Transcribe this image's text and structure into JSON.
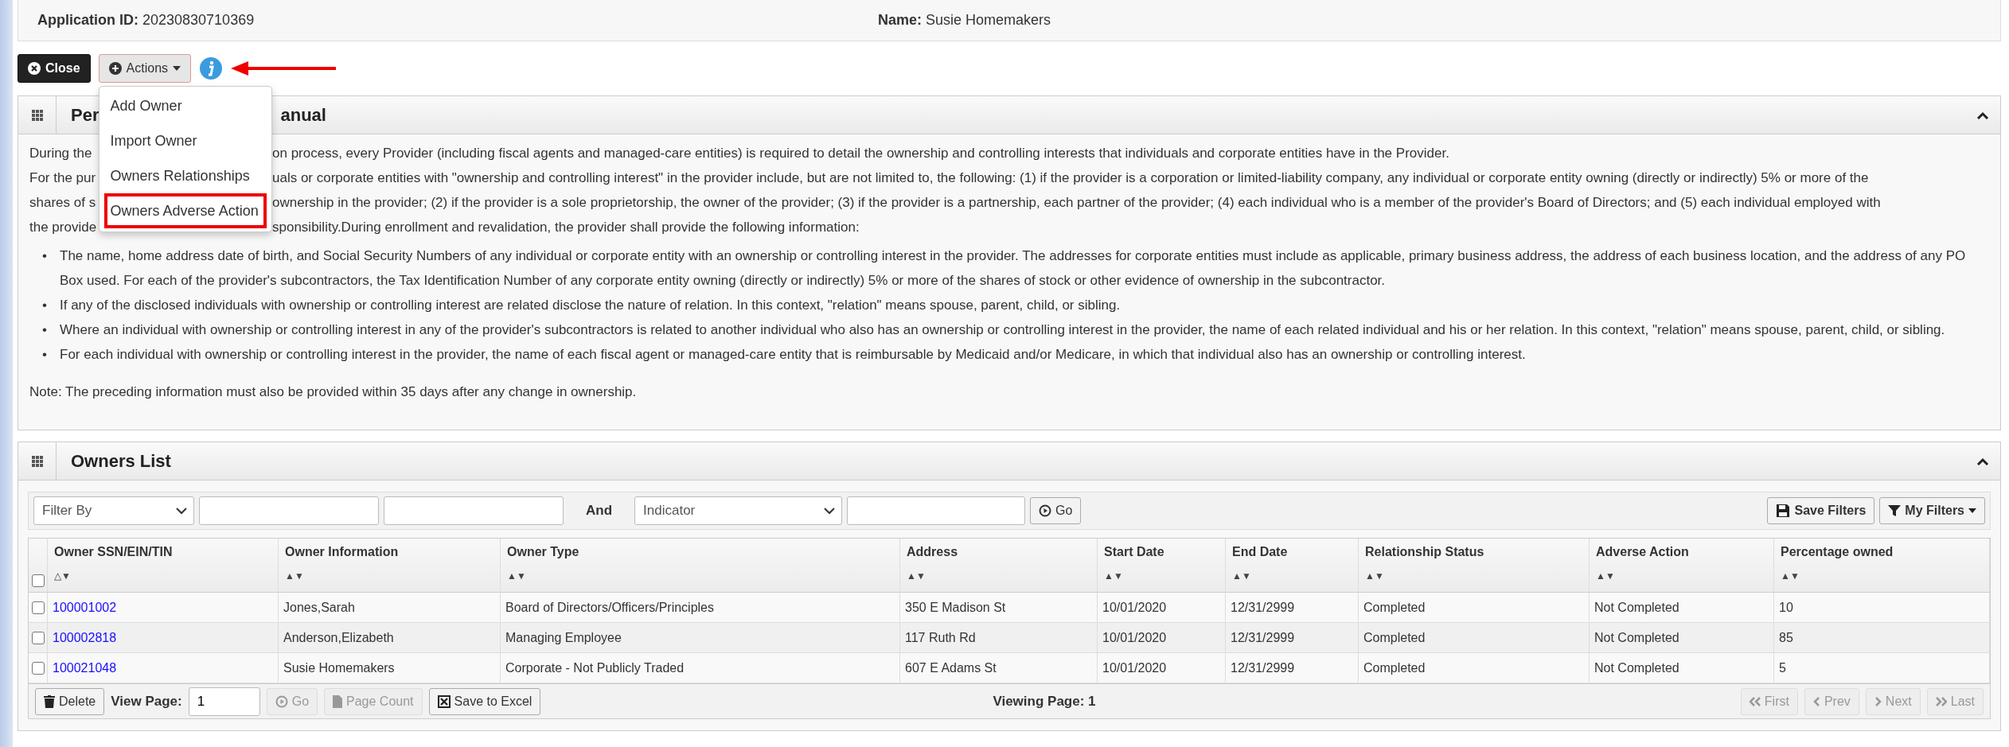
{
  "header": {
    "application_id_label": "Application ID:",
    "application_id": "20230830710369",
    "name_label": "Name:",
    "name": "Susie Homemakers"
  },
  "toolbar": {
    "close": "Close",
    "actions": "Actions",
    "actions_expanded": true,
    "info_arrow": true
  },
  "actions_menu": [
    {
      "label": "Add Owner",
      "highlighted": false
    },
    {
      "label": "Import Owner",
      "highlighted": false
    },
    {
      "label": "Owners Relationships",
      "highlighted": false
    },
    {
      "label": "Owners Adverse Action",
      "highlighted": true
    }
  ],
  "manual_panel": {
    "title_start": "Per",
    "title_end": "anual",
    "expanded": true,
    "intro_lines": [
      {
        "left": "During the",
        "right": "on process, every Provider (including fiscal agents and managed-care entities) is required to detail the ownership and controlling interests that individuals and corporate entities have in the Provider."
      },
      {
        "left": "For the pur",
        "right": "uals or corporate entities with \"ownership and controlling interest\" in the provider include, but are not limited to, the following: (1) if the provider is a corporation or limited-liability company, any individual or corporate entity owning (directly or indirectly) 5% or more of the"
      },
      {
        "left": "shares of s",
        "right": "ownership in the provider; (2) if the provider is a sole proprietorship, the owner of the provider; (3) if the provider is a partnership, each partner of the provider; (4) each individual who is a member of the provider's Board of Directors; and (5) each individual employed with"
      },
      {
        "left": "the provide",
        "right": "sponsibility.During enrollment and revalidation, the provider shall provide the following information:"
      }
    ],
    "bullet_marker": "•",
    "bullets": [
      "The name, home address date of birth, and Social Security Numbers of any individual or corporate entity with an ownership or controlling interest in the provider. The addresses for corporate entities must include as applicable, primary business address, the address of each business location, and the address of any PO Box used. For each of the provider's subcontractors, the Tax Identification Number of any corporate entity owning (directly or indirectly) 5% or more of the shares of stock or other evidence of ownership in the subcontractor.",
      "If any of the disclosed individuals with ownership or controlling interest are related disclose the nature of relation. In this context, \"relation\" means spouse, parent, child, or sibling.",
      "Where an individual with ownership or controlling interest in any of the provider's subcontractors is related to another individual who also has an ownership or controlling interest in the provider, the name of each related individual and his or her relation. In this context, \"relation\" means spouse, parent, child, or sibling.",
      "For each individual with ownership or controlling interest in the provider, the name of each fiscal agent or managed-care entity that is reimbursable by Medicaid and/or Medicare, in which that individual also has an ownership or controlling interest."
    ],
    "note": "Note: The preceding information must also be provided within 35 days after any change in ownership."
  },
  "owners_panel": {
    "title": "Owners List",
    "expanded": true,
    "filter": {
      "filter_by": "Filter By",
      "and_label": "And",
      "indicator": "Indicator",
      "go": "Go",
      "save_filters": "Save Filters",
      "my_filters": "My Filters"
    },
    "select_all_checked": false,
    "columns": [
      {
        "label": "Owner SSN/EIN/TIN",
        "sort": "△▼"
      },
      {
        "label": "Owner Information",
        "sort": "▲▼"
      },
      {
        "label": "Owner Type",
        "sort": "▲▼"
      },
      {
        "label": "Address",
        "sort": "▲▼"
      },
      {
        "label": "Start Date",
        "sort": "▲▼"
      },
      {
        "label": "End Date",
        "sort": "▲▼"
      },
      {
        "label": "Relationship Status",
        "sort": "▲▼"
      },
      {
        "label": "Adverse Action",
        "sort": "▲▼"
      },
      {
        "label": "Percentage owned",
        "sort": "▲▼"
      }
    ],
    "rows": [
      {
        "checked": false,
        "cells": [
          "100001002",
          "Jones,Sarah",
          "Board of Directors/Officers/Principles",
          "350 E Madison St",
          "10/01/2020",
          "12/31/2999",
          "Completed",
          "Not Completed",
          "10"
        ]
      },
      {
        "checked": false,
        "cells": [
          "100002818",
          "Anderson,Elizabeth",
          "Managing Employee",
          "117 Ruth Rd",
          "10/01/2020",
          "12/31/2999",
          "Completed",
          "Not Completed",
          "85"
        ]
      },
      {
        "checked": false,
        "cells": [
          "100021048",
          "Susie Homemakers",
          "Corporate - Not Publicly Traded",
          "607 E Adams St",
          "10/01/2020",
          "12/31/2999",
          "Completed",
          "Not Completed",
          "5"
        ]
      }
    ],
    "footer": {
      "delete": "Delete",
      "view_page_label": "View Page:",
      "view_page": "1",
      "go": "Go",
      "go_disabled": true,
      "page_count": "Page Count",
      "page_count_disabled": true,
      "save_excel": "Save to Excel",
      "viewing": "Viewing Page: 1",
      "pager": [
        {
          "kind": "first",
          "label": "First",
          "disabled": true
        },
        {
          "kind": "prev",
          "label": "Prev",
          "disabled": true
        },
        {
          "kind": "next",
          "label": "Next",
          "disabled": true
        },
        {
          "kind": "last",
          "label": "Last",
          "disabled": true
        }
      ]
    }
  }
}
